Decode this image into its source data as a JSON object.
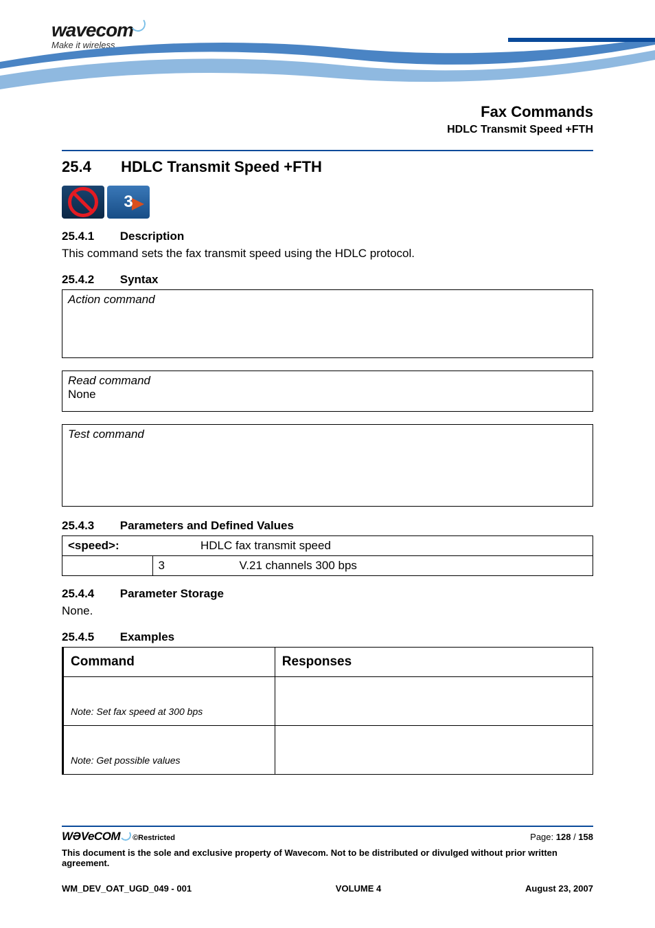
{
  "brand": {
    "name": "wavecom",
    "tagline": "Make it wireless"
  },
  "header": {
    "category": "Fax Commands",
    "subtitle": "HDLC Transmit Speed +FTH"
  },
  "section": {
    "number": "25.4",
    "title": "HDLC Transmit Speed +FTH"
  },
  "icons": {
    "nosign": "no-sign-icon",
    "three": "3"
  },
  "sub_description": {
    "number": "25.4.1",
    "title": "Description",
    "text": "This command sets the fax transmit speed using the HDLC protocol."
  },
  "sub_syntax": {
    "number": "25.4.2",
    "title": "Syntax",
    "action": "Action command",
    "read_label": "Read command",
    "read_value": "None",
    "test_label": "Test command"
  },
  "sub_params": {
    "number": "25.4.3",
    "title": "Parameters and Defined Values",
    "param_name": "<speed>:",
    "param_desc": "HDLC fax transmit speed",
    "rows": [
      {
        "value": "3",
        "desc": "V.21 channels 300 bps"
      }
    ]
  },
  "sub_storage": {
    "number": "25.4.4",
    "title": "Parameter Storage",
    "text": "None."
  },
  "sub_examples": {
    "number": "25.4.5",
    "title": "Examples",
    "col_command": "Command",
    "col_responses": "Responses",
    "rows": [
      {
        "note": "Note: Set fax speed at 300 bps"
      },
      {
        "note": "Note: Get possible values"
      }
    ]
  },
  "footer": {
    "brand": "WƏVeCOM",
    "restricted": "©Restricted",
    "page_label": "Page: ",
    "page_current": "128",
    "page_sep": " / ",
    "page_total": "158",
    "disclaimer": "This document is the sole and exclusive property of Wavecom. Not to be distributed or divulged without prior written agreement.",
    "doc_id": "WM_DEV_OAT_UGD_049 - 001",
    "volume": "VOLUME 4",
    "date": "August 23, 2007"
  }
}
